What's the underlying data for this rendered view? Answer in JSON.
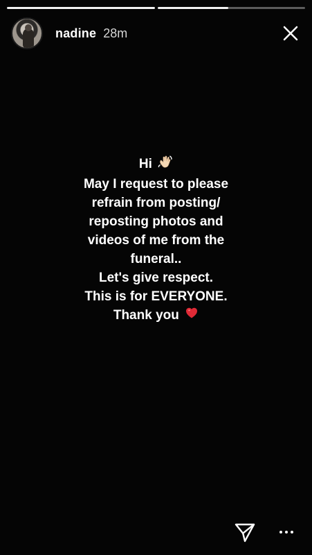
{
  "progress": [
    {
      "fill": 1.0
    },
    {
      "fill": 0.48
    }
  ],
  "header": {
    "username": "nadine",
    "time": "28m",
    "close_icon": "close-icon"
  },
  "message": {
    "lines": [
      "Hi",
      "May I request to  please",
      "refrain from posting/",
      "reposting photos and",
      "videos of me from the",
      "funeral..",
      "Let's give respect.",
      "This is for EVERYONE.",
      "Thank you"
    ],
    "wave_emoji": "waving-hand-icon",
    "heart_emoji": "red-heart-icon"
  },
  "footer": {
    "send_icon": "paper-plane-icon",
    "more_icon": "more-icon"
  },
  "colors": {
    "background": "#050505",
    "text": "#ffffff",
    "muted": "#d6d6d6",
    "heart": "#e02a36"
  }
}
